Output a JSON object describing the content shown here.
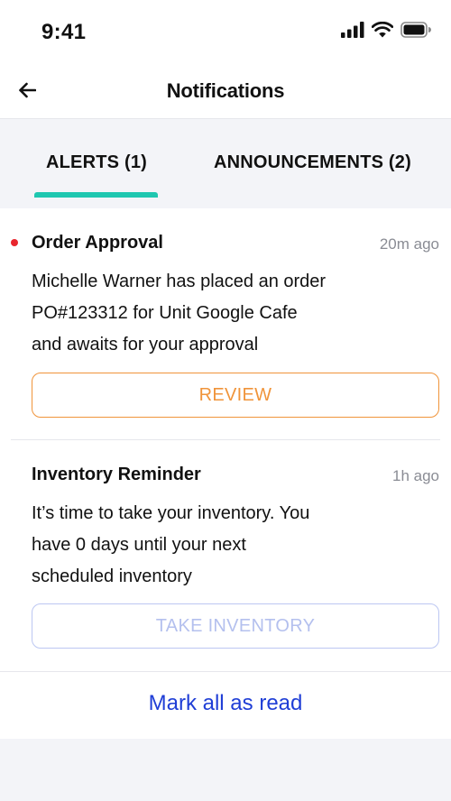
{
  "status_bar": {
    "time": "9:41",
    "icons": [
      "signal-icon",
      "wifi-icon",
      "battery-icon"
    ]
  },
  "header": {
    "title": "Notifications",
    "back_icon": "arrow-left-icon"
  },
  "tabs": [
    {
      "label": "ALERTS (1)",
      "active": true
    },
    {
      "label": "ANNOUNCEMENTS (2)",
      "active": false
    }
  ],
  "notifications": [
    {
      "title": "Order Approval",
      "time": "20m ago",
      "unread": true,
      "body_lines": [
        "Michelle Warner has placed an order",
        "PO#123312 for Unit Google Cafe",
        "and awaits for your approval"
      ],
      "action_label": "REVIEW"
    },
    {
      "title": "Inventory Reminder",
      "time": "1h ago",
      "unread": false,
      "body_lines": [
        "It’s time to take your inventory. You",
        "have 0 days until your next",
        "scheduled inventory"
      ],
      "action_label": "TAKE INVENTORY"
    }
  ],
  "footer": {
    "mark_all_label": "Mark all as read"
  },
  "colors": {
    "accent_teal": "#1fc7b0",
    "review_orange": "#f0943a",
    "disabled_blue": "#b4c0ee",
    "link_blue": "#1f3ed6",
    "unread_red": "#e8262e"
  }
}
